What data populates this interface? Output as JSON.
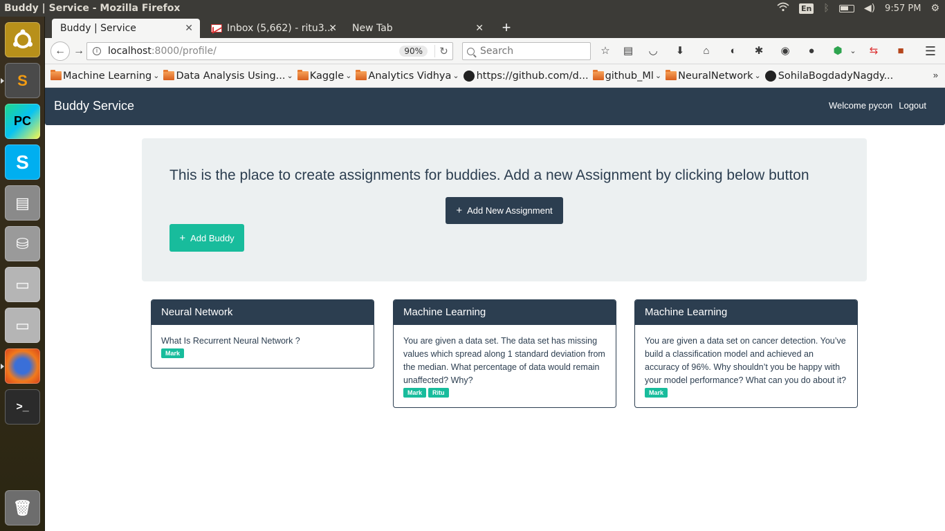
{
  "panel": {
    "window_title": "Buddy | Service - Mozilla Firefox",
    "keyboard": "En",
    "clock": "9:57 PM"
  },
  "tabs": [
    {
      "label": "Buddy | Service"
    },
    {
      "label": "Inbox (5,662) - ritu3..."
    },
    {
      "label": "New Tab"
    }
  ],
  "nav": {
    "url_host": "localhost",
    "url_rest": ":8000/profile/",
    "zoom": "90%",
    "search_placeholder": "Search"
  },
  "bookmarks": [
    {
      "label": "Machine Learning",
      "type": "folder"
    },
    {
      "label": "Data Analysis Using...",
      "type": "folder"
    },
    {
      "label": "Kaggle",
      "type": "folder"
    },
    {
      "label": "Analytics Vidhya",
      "type": "folder"
    },
    {
      "label": "https://github.com/d...",
      "type": "link"
    },
    {
      "label": "github_Ml",
      "type": "folder"
    },
    {
      "label": "NeuralNetwork",
      "type": "folder"
    },
    {
      "label": "SohilaBogdadyNagdy...",
      "type": "link"
    }
  ],
  "site": {
    "brand": "Buddy Service",
    "welcome": "Welcome pycon",
    "logout": "Logout",
    "jumbotron_text": "This is the place to create assignments for buddies. Add a new Assignment by clicking below button",
    "add_assignment": "Add New Assignment",
    "add_buddy": "Add Buddy",
    "accent": "#18bc9c",
    "primary": "#2c3e50"
  },
  "cards": [
    {
      "title": "Neural Network",
      "text": "What Is Recurrent Neural Network ?",
      "tags": [
        "Mark"
      ]
    },
    {
      "title": "Machine Learning",
      "text": "You are given a data set. The data set has missing values which spread along 1 standard deviation from the median. What percentage of data would remain unaffected? Why?",
      "tags": [
        "Mark",
        "Ritu"
      ]
    },
    {
      "title": "Machine Learning",
      "text": "You are given a data set on cancer detection. You’ve build a classification model and achieved an accuracy of 96%. Why shouldn’t you be happy with your model performance? What can you do about it?",
      "tags": [
        "Mark"
      ]
    }
  ]
}
